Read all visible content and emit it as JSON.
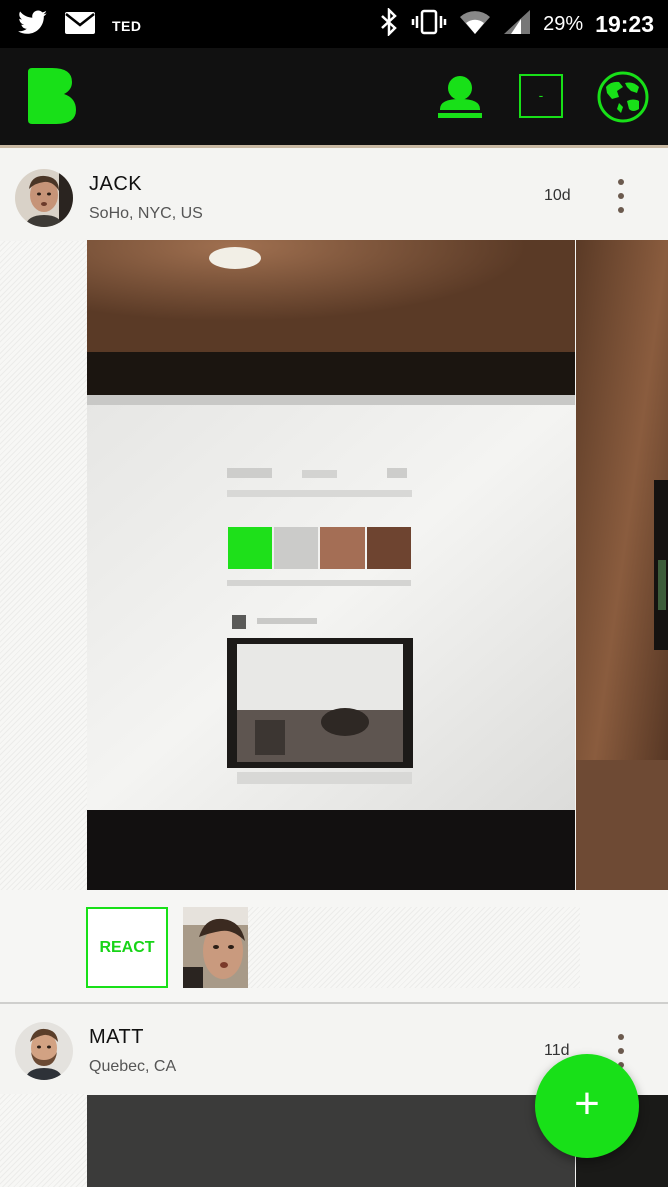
{
  "status_bar": {
    "left_icons": [
      "twitter-icon",
      "mail-icon"
    ],
    "app_label": "TED",
    "battery": "29%",
    "time": "19:23"
  },
  "app_bar": {
    "logo_icon": "b-logo-icon",
    "square_label": "-",
    "accent_color": "#18e018"
  },
  "posts": [
    {
      "name": "JACK",
      "location": "SoHo, NYC, US",
      "age": "10d",
      "tags": [
        {
          "label": "REACT"
        }
      ]
    },
    {
      "name": "MATT",
      "location": "Quebec, CA",
      "age": "11d"
    }
  ],
  "fab": {
    "label": "+"
  }
}
